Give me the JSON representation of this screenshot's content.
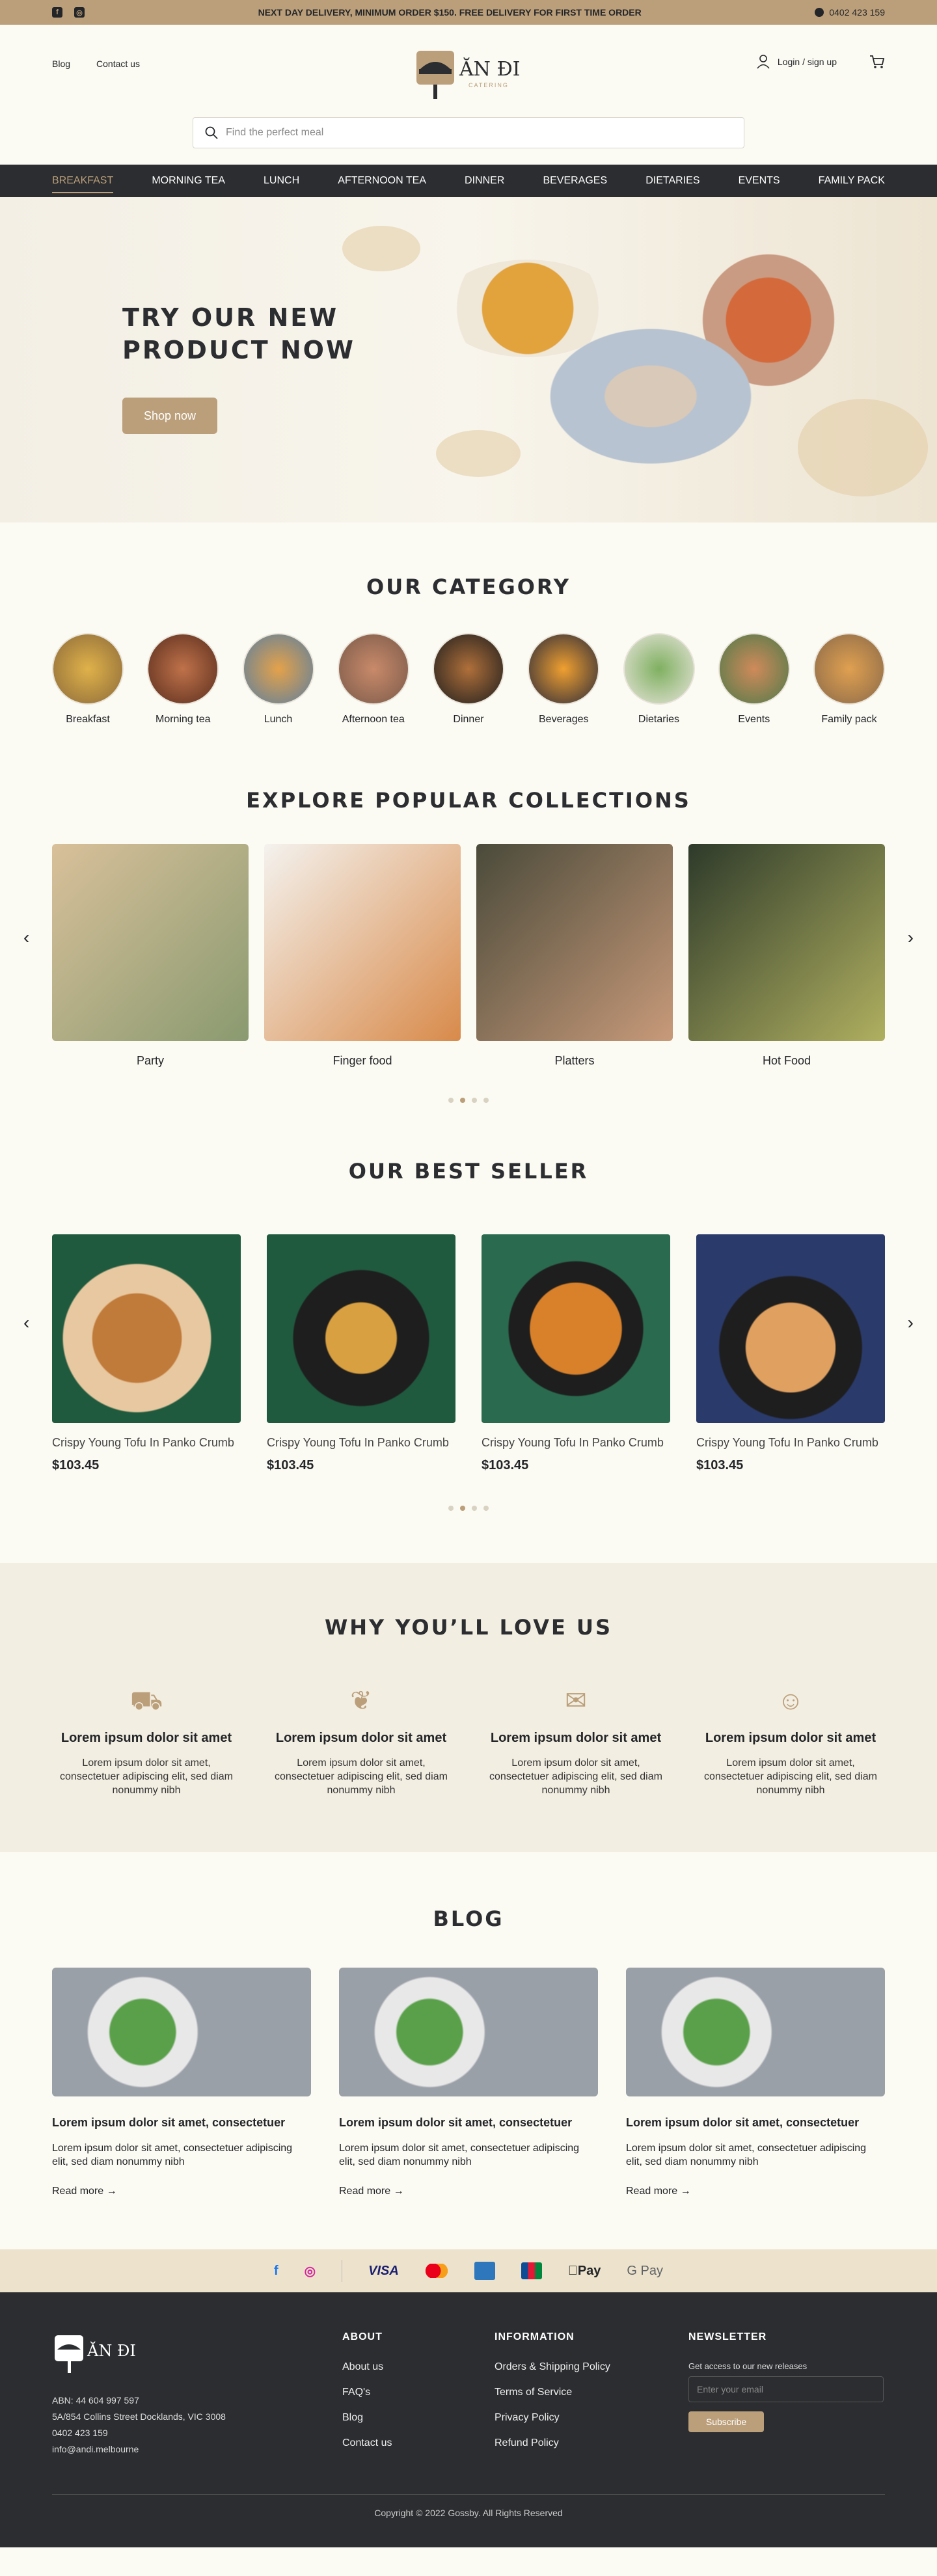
{
  "topbar": {
    "announcement": "NEXT DAY DELIVERY, MINIMUM ORDER $150. FREE DELIVERY FOR FIRST TIME ORDER",
    "phone": "0402 423 159"
  },
  "header": {
    "links": [
      "Blog",
      "Contact us"
    ],
    "login": "Login / sign up",
    "brand": "ĂN ĐI",
    "brand_sub": "CATERING"
  },
  "search": {
    "placeholder": "Find the perfect meal"
  },
  "nav": [
    "BREAKFAST",
    "MORNING TEA",
    "LUNCH",
    "AFTERNOON TEA",
    "DINNER",
    "BEVERAGES",
    "DIETARIES",
    "EVENTS",
    "FAMILY PACK"
  ],
  "hero": {
    "line1": "TRY OUR NEW",
    "line2": "PRODUCT NOW",
    "cta": "Shop now"
  },
  "category": {
    "title": "OUR CATEGORY",
    "items": [
      "Breakfast",
      "Morning tea",
      "Lunch",
      "Afternoon tea",
      "Dinner",
      "Beverages",
      "Dietaries",
      "Events",
      "Family pack"
    ]
  },
  "collections": {
    "title": "EXPLORE POPULAR COLLECTIONS",
    "items": [
      "Party",
      "Finger food",
      "Platters",
      "Hot Food"
    ]
  },
  "bestseller": {
    "title": "OUR BEST SELLER",
    "items": [
      {
        "name": "Crispy Young Tofu In Panko Crumb",
        "price": "$103.45"
      },
      {
        "name": "Crispy Young Tofu In Panko Crumb",
        "price": "$103.45"
      },
      {
        "name": "Crispy Young Tofu In Panko Crumb",
        "price": "$103.45"
      },
      {
        "name": "Crispy Young Tofu In Panko Crumb",
        "price": "$103.45"
      }
    ]
  },
  "why": {
    "title": "WHY YOU’LL LOVE US",
    "items": [
      {
        "heading": "Lorem ipsum dolor sit amet",
        "text": "Lorem ipsum dolor sit amet, consectetuer adipiscing elit, sed diam nonummy nibh"
      },
      {
        "heading": "Lorem ipsum dolor sit amet",
        "text": "Lorem ipsum dolor sit amet, consectetuer adipiscing elit, sed diam nonummy nibh"
      },
      {
        "heading": "Lorem ipsum dolor sit amet",
        "text": "Lorem ipsum dolor sit amet, consectetuer adipiscing elit, sed diam nonummy nibh"
      },
      {
        "heading": "Lorem ipsum dolor sit amet",
        "text": "Lorem ipsum dolor sit amet, consectetuer adipiscing elit, sed diam nonummy nibh"
      }
    ]
  },
  "blog": {
    "title": "BLOG",
    "posts": [
      {
        "title": "Lorem ipsum dolor sit amet, consectetuer",
        "text": "Lorem ipsum dolor sit amet, consectetuer adipiscing elit, sed diam nonummy nibh",
        "more": "Read more"
      },
      {
        "title": "Lorem ipsum dolor sit amet, consectetuer",
        "text": "Lorem ipsum dolor sit amet, consectetuer adipiscing elit, sed diam nonummy nibh",
        "more": "Read more"
      },
      {
        "title": "Lorem ipsum dolor sit amet, consectetuer",
        "text": "Lorem ipsum dolor sit amet, consectetuer adipiscing elit, sed diam nonummy nibh",
        "more": "Read more"
      }
    ]
  },
  "payments": [
    "VISA",
    "Pay",
    "G Pay"
  ],
  "footer": {
    "brand": "ĂN ĐI",
    "abn": "ABN: 44 604 997 597",
    "address": "5A/854 Collins Street Docklands, VIC 3008",
    "phone": "0402 423 159",
    "email": "info@andi.melbourne",
    "about_title": "ABOUT",
    "about": [
      "About us",
      "FAQ's",
      "Blog",
      "Contact us"
    ],
    "info_title": "INFORMATION",
    "info": [
      "Orders & Shipping Policy",
      "Terms of Service",
      "Privacy Policy",
      "Refund Policy"
    ],
    "news_title": "NEWSLETTER",
    "news_text": "Get access to our new releases",
    "news_placeholder": "Enter your email",
    "subscribe": "Subscribe",
    "copyright": "Copyright © 2022 Gossby. All Rights Reserved"
  },
  "colors": {
    "accent": "#bb9f7a",
    "dark": "#2b2d30",
    "bg": "#fbfaf3"
  }
}
